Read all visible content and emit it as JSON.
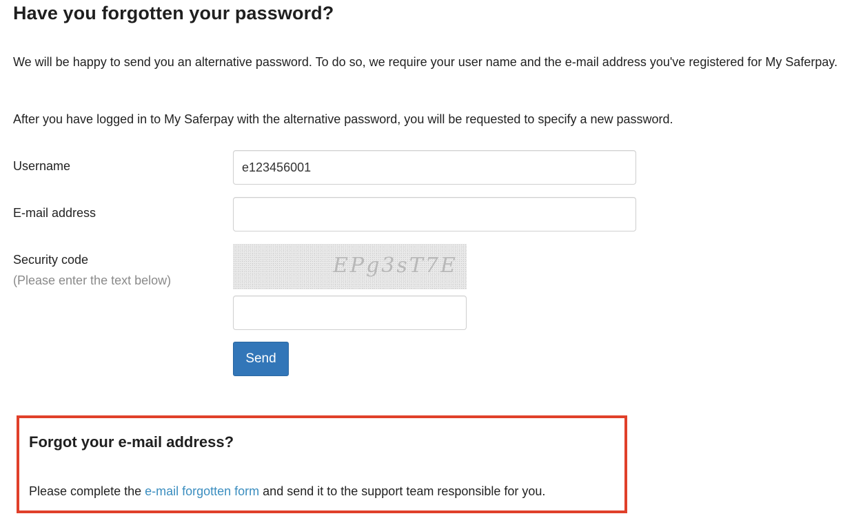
{
  "page": {
    "title": "Have you forgotten your password?",
    "intro_1": "We will be happy to send you an alternative password. To do so, we require your user name and the e-mail address you've registered for My Saferpay.",
    "intro_2": "After you have logged in to My Saferpay with the alternative password, you will be requested to specify a new password."
  },
  "form": {
    "username": {
      "label": "Username",
      "value": "e123456001"
    },
    "email": {
      "label": "E-mail address",
      "value": ""
    },
    "security_code": {
      "label": "Security code",
      "hint": "(Please enter the text below)",
      "captcha_text": "EPg3sT7E",
      "value": ""
    },
    "send_label": "Send"
  },
  "email_forgotten": {
    "title": "Forgot your e-mail address?",
    "text_before": "Please complete the ",
    "link_text": "e-mail forgotten form",
    "text_after": " and send it to the support team responsible for you."
  },
  "colors": {
    "button": "#3276b8",
    "link": "#3a8dbf",
    "highlight_border": "#e0402a"
  }
}
